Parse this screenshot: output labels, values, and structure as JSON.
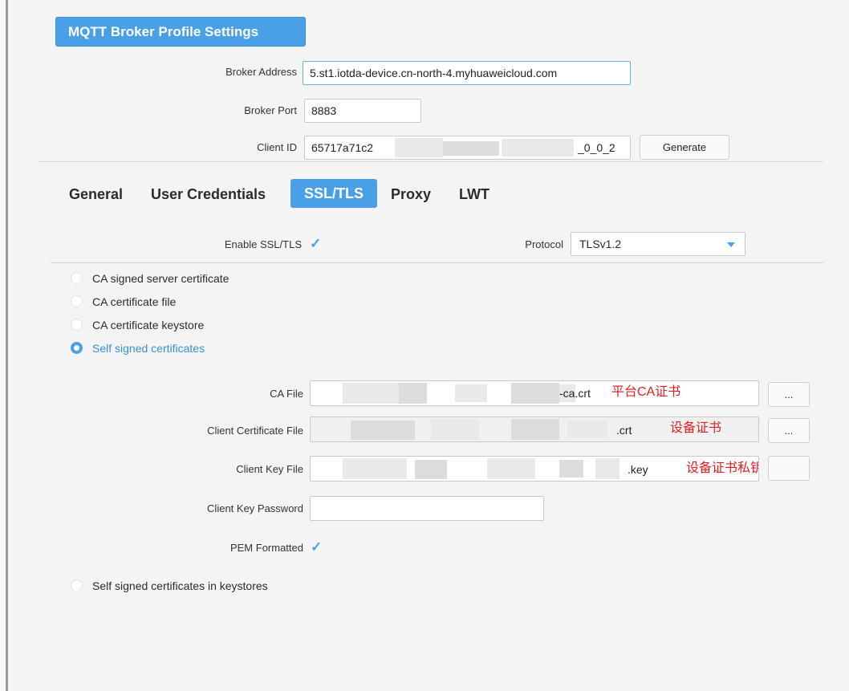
{
  "header": {
    "title": "MQTT Broker Profile Settings"
  },
  "broker": {
    "address_label": "Broker Address",
    "address_value": "5.st1.iotda-device.cn-north-4.myhuaweicloud.com",
    "port_label": "Broker Port",
    "port_value": "8883",
    "client_id_label": "Client ID",
    "client_id_prefix": "65717a71c2",
    "client_id_suffix": "_0_0_2",
    "generate_label": "Generate"
  },
  "tabs": [
    {
      "label": "General"
    },
    {
      "label": "User Credentials"
    },
    {
      "label": "SSL/TLS"
    },
    {
      "label": "Proxy"
    },
    {
      "label": "LWT"
    }
  ],
  "ssl": {
    "enable_label": "Enable SSL/TLS",
    "enable_checked": "✓",
    "protocol_label": "Protocol",
    "protocol_value": "TLSv1.2"
  },
  "options": [
    {
      "label": "CA signed server certificate"
    },
    {
      "label": "CA certificate file"
    },
    {
      "label": "CA certificate keystore"
    },
    {
      "label": "Self signed certificates"
    }
  ],
  "fields": {
    "ca_file_label": "CA File",
    "ca_file_value": "-ca.crt",
    "ca_file_note": "平台CA证书",
    "client_cert_label": "Client Certificate File",
    "client_cert_value": ".crt",
    "client_cert_note": "设备证书",
    "client_key_label": "Client Key File",
    "client_key_value": ".key",
    "client_key_note": "设备证书私钥",
    "client_key_password_label": "Client Key Password",
    "browse_label": "...",
    "pem_label": "PEM Formatted",
    "pem_checked": "✓"
  },
  "keystore_option": {
    "label": "Self signed certificates in keystores"
  },
  "colors": {
    "accent": "#4aa0e6",
    "annotation": "#e02020"
  }
}
